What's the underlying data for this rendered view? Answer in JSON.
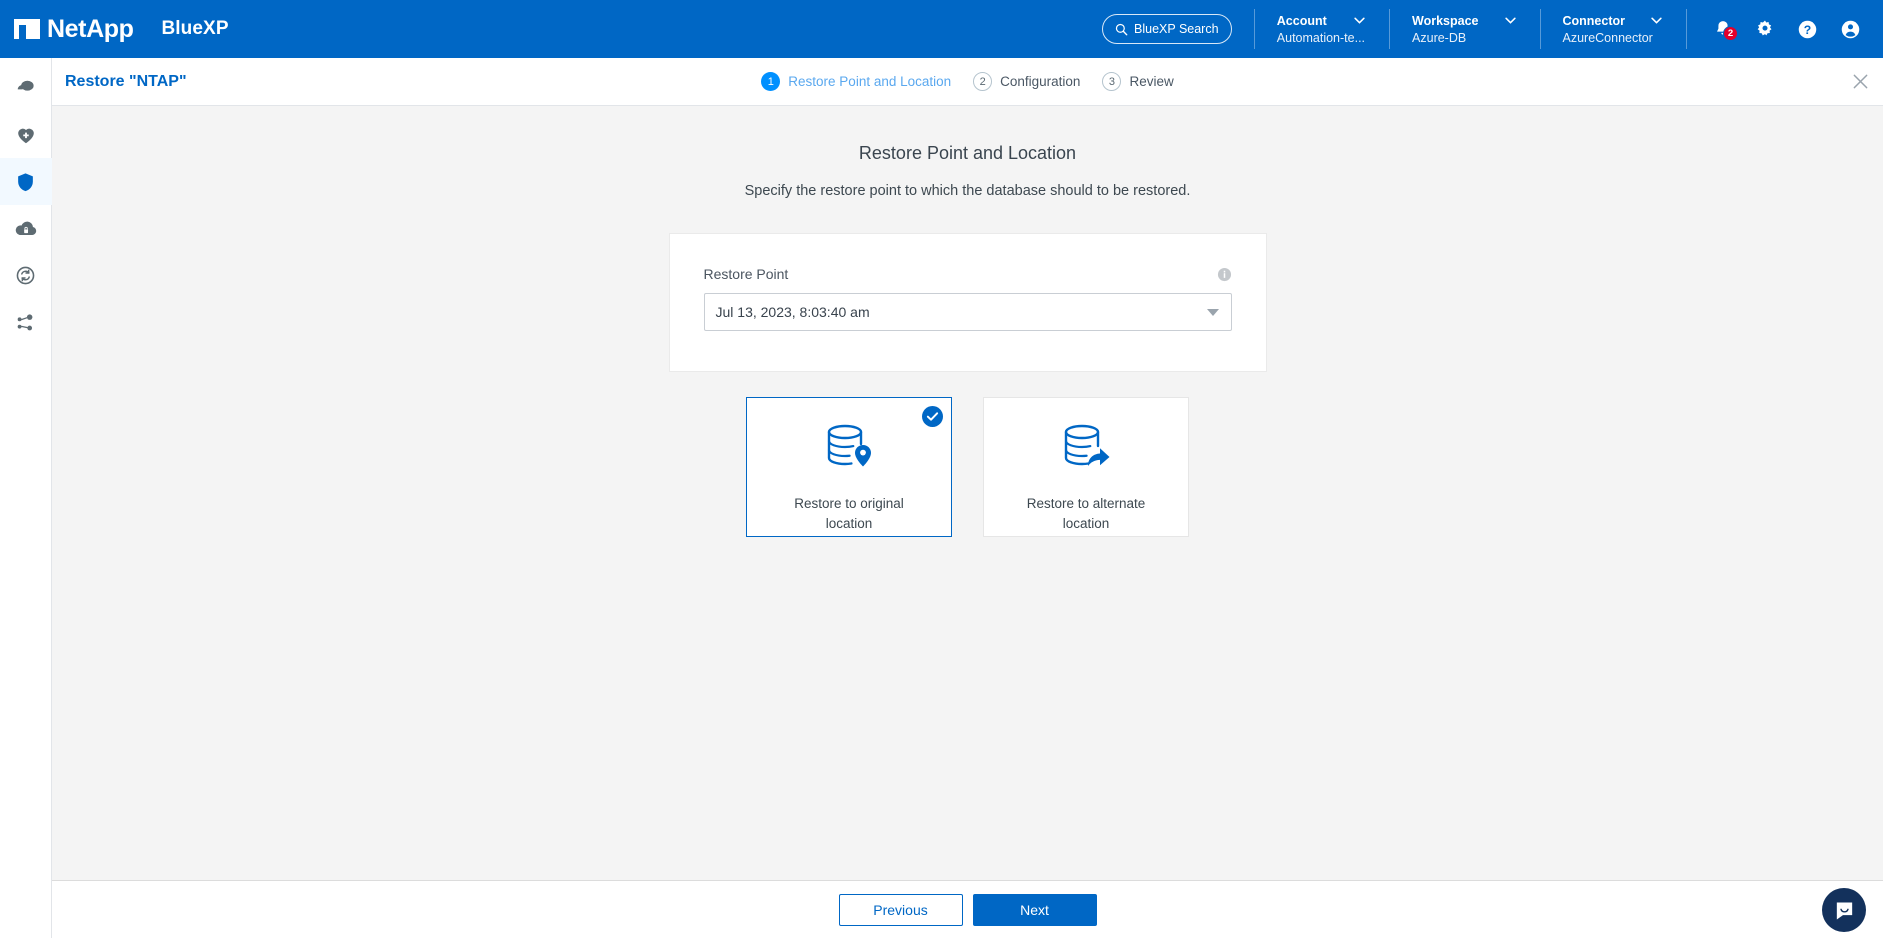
{
  "header": {
    "brand": "NetApp",
    "product": "BlueXP",
    "search_label": "BlueXP Search",
    "selectors": [
      {
        "name": "account",
        "label": "Account",
        "value": "Automation-te..."
      },
      {
        "name": "workspace",
        "label": "Workspace",
        "value": "Azure-DB"
      },
      {
        "name": "connector",
        "label": "Connector",
        "value": "AzureConnector"
      }
    ],
    "icons": [
      {
        "name": "notifications-icon",
        "badge": "2"
      },
      {
        "name": "settings-gear-icon",
        "badge": ""
      },
      {
        "name": "help-icon",
        "badge": ""
      },
      {
        "name": "user-account-icon",
        "badge": ""
      }
    ]
  },
  "sidebar": {
    "items": [
      {
        "name": "canvas-icon",
        "active": false
      },
      {
        "name": "health-icon",
        "active": false
      },
      {
        "name": "protection-shield-icon",
        "active": true
      },
      {
        "name": "governance-lock-icon",
        "active": false
      },
      {
        "name": "mobility-sync-icon",
        "active": false
      },
      {
        "name": "extensions-icon",
        "active": false
      }
    ]
  },
  "wizard": {
    "title": "Restore \"NTAP\"",
    "close_label": "×",
    "steps": [
      {
        "num": "1",
        "label": "Restore Point and Location",
        "state": "current"
      },
      {
        "num": "2",
        "label": "Configuration",
        "state": "pending"
      },
      {
        "num": "3",
        "label": "Review",
        "state": "pending"
      }
    ]
  },
  "main": {
    "title": "Restore Point and Location",
    "subtitle": "Specify the restore point to which the database should to be restored.",
    "restore_point": {
      "label": "Restore Point",
      "info_icon": "info-icon",
      "selected_value": "Jul 13, 2023, 8:03:40 am",
      "options": [
        "Jul 13, 2023, 8:03:40 am"
      ]
    },
    "location_tiles": [
      {
        "name": "restore-original-location",
        "icon": "database-pin-icon",
        "label": "Restore to original location",
        "selected": true
      },
      {
        "name": "restore-alternate-location",
        "icon": "database-arrow-icon",
        "label": "Restore to alternate location",
        "selected": false
      }
    ]
  },
  "footer": {
    "previous_label": "Previous",
    "next_label": "Next"
  },
  "chat": {
    "name": "chat-widget-button"
  },
  "colors": {
    "brand_blue": "#0067c5",
    "step_active_blue": "#0090ff",
    "badge_red": "#e4002b",
    "body_bg": "#f4f4f4",
    "chat_navy": "#13315c"
  }
}
